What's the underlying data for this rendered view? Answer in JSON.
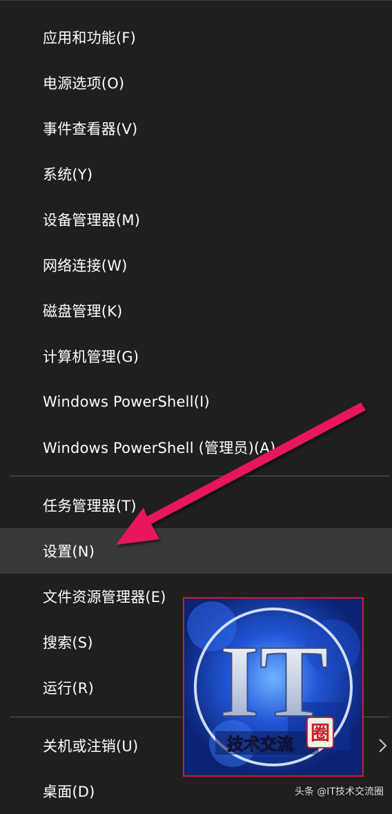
{
  "menu": {
    "items": [
      {
        "label": "应用和功能(F)"
      },
      {
        "label": "电源选项(O)"
      },
      {
        "label": "事件查看器(V)"
      },
      {
        "label": "系统(Y)"
      },
      {
        "label": "设备管理器(M)"
      },
      {
        "label": "网络连接(W)"
      },
      {
        "label": "磁盘管理(K)"
      },
      {
        "label": "计算机管理(G)"
      },
      {
        "label": "Windows PowerShell(I)"
      },
      {
        "label": "Windows PowerShell (管理员)(A)"
      },
      {
        "label": "任务管理器(T)"
      },
      {
        "label": "设置(N)"
      },
      {
        "label": "文件资源管理器(E)"
      },
      {
        "label": "搜索(S)"
      },
      {
        "label": "运行(R)"
      },
      {
        "label": "关机或注销(U)"
      },
      {
        "label": "桌面(D)"
      }
    ],
    "hovered_item": "设置(N)",
    "background_color": "#1f1f1f",
    "hover_color": "#393939"
  },
  "annotation": {
    "arrow_color": "#e8195a"
  },
  "logo": {
    "text_main": "IT",
    "text_sub": "技术交流",
    "text_stamp": "圈",
    "border_color": "#c8202a"
  },
  "watermark": {
    "text": "头条 @IT技术交流圈"
  }
}
